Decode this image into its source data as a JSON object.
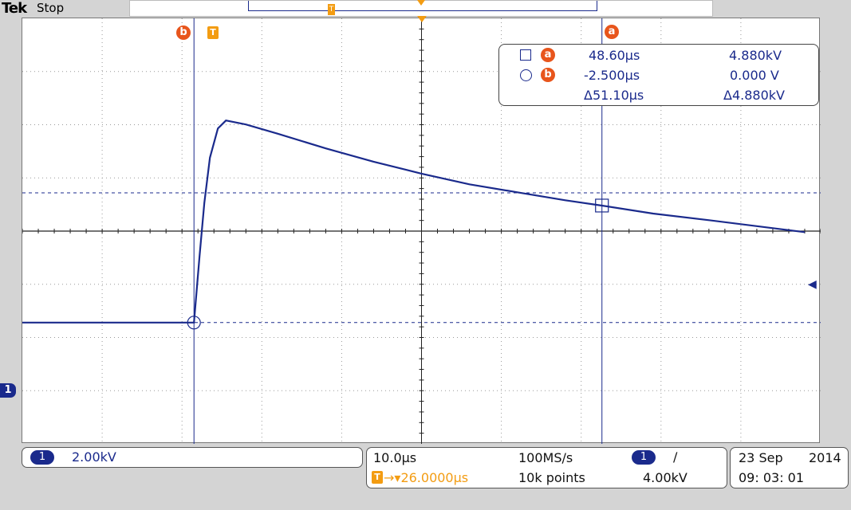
{
  "header": {
    "brand": "Tek",
    "state": "Stop"
  },
  "markers": {
    "cursor_a": "a",
    "cursor_b": "b",
    "trigger": "T",
    "channel": "1"
  },
  "readout": {
    "row_a": {
      "time": "48.60µs",
      "value": "4.880kV"
    },
    "row_b": {
      "time": "-2.500µs",
      "value": "0.000 V"
    },
    "delta": {
      "time": "Δ51.10µs",
      "value": "Δ4.880kV"
    }
  },
  "status": {
    "channel_scale": "2.00kV",
    "timebase": "10.0µs",
    "trigger_position": "→▾26.0000µs",
    "sample_rate": "100MS/s",
    "record_length": "10k points",
    "trigger_source": "1",
    "trigger_slope": "∕",
    "trigger_level": "4.00kV",
    "date": "23 Sep",
    "year": "2014",
    "time": "09: 03: 01"
  },
  "colors": {
    "trace": "#1a2a8c",
    "cursor_marker": "#e8551c",
    "trigger_marker": "#f39c12",
    "background": "#d4d4d4"
  },
  "waveform": {
    "x_unit": "µs",
    "y_unit": "kV",
    "points": [
      {
        "x": -26,
        "y": 0
      },
      {
        "x": -2.5,
        "y": 0
      },
      {
        "x": -1.8,
        "y": 2.5
      },
      {
        "x": -1.2,
        "y": 4.5
      },
      {
        "x": -0.5,
        "y": 6.2
      },
      {
        "x": 0.5,
        "y": 7.3
      },
      {
        "x": 1.5,
        "y": 7.6
      },
      {
        "x": 4,
        "y": 7.45
      },
      {
        "x": 8,
        "y": 7.1
      },
      {
        "x": 14,
        "y": 6.55
      },
      {
        "x": 20,
        "y": 6.05
      },
      {
        "x": 26,
        "y": 5.6
      },
      {
        "x": 32,
        "y": 5.2
      },
      {
        "x": 38,
        "y": 4.9
      },
      {
        "x": 44,
        "y": 4.6
      },
      {
        "x": 48.6,
        "y": 4.4
      },
      {
        "x": 55,
        "y": 4.1
      },
      {
        "x": 62,
        "y": 3.85
      },
      {
        "x": 74,
        "y": 3.4
      }
    ]
  }
}
